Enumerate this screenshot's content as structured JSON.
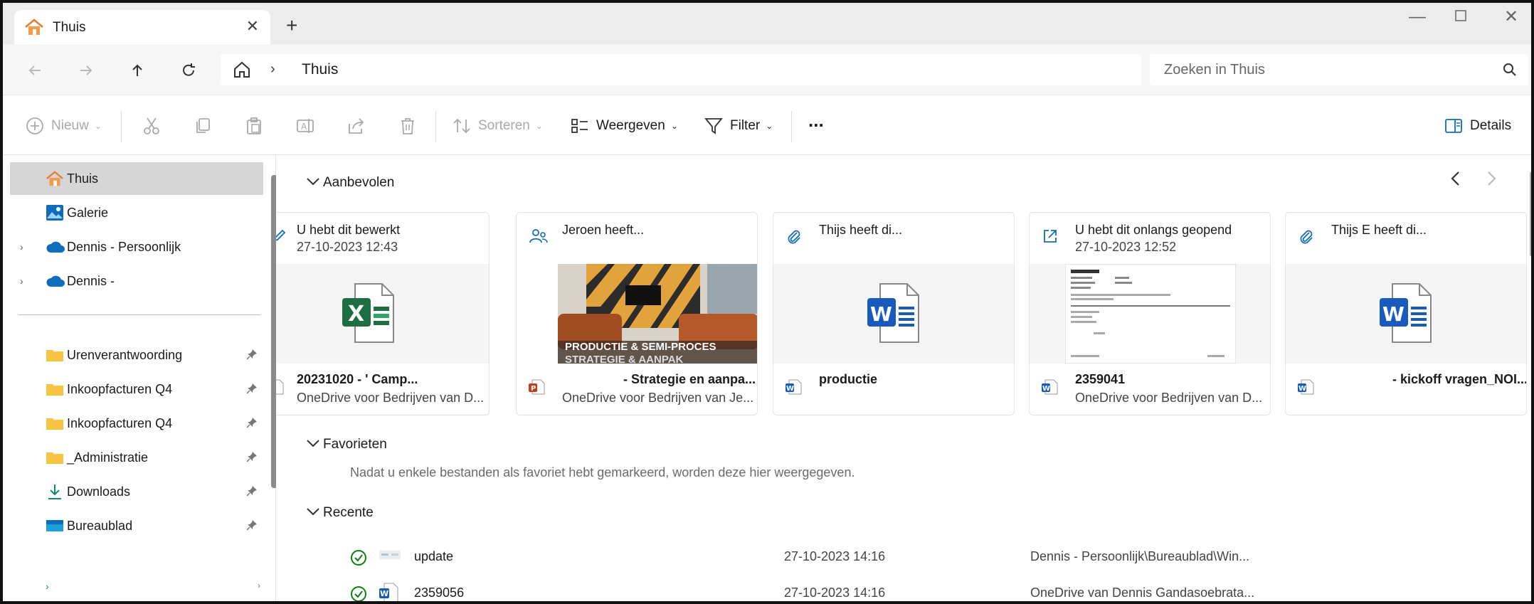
{
  "tab": {
    "title": "Thuis"
  },
  "address": {
    "current": "Thuis"
  },
  "search": {
    "placeholder": "Zoeken in Thuis"
  },
  "toolbar": {
    "new_label": "Nieuw",
    "sort_label": "Sorteren",
    "view_label": "Weergeven",
    "filter_label": "Filter",
    "more_label": "...",
    "details_label": "Details"
  },
  "sidebar": {
    "items": [
      {
        "label": "Thuis"
      },
      {
        "label": "Galerie"
      },
      {
        "label": "Dennis - Persoonlijk"
      },
      {
        "label": "Dennis -"
      }
    ],
    "pinned": [
      {
        "label": "Urenverantwoording"
      },
      {
        "label": "Inkoopfacturen Q4"
      },
      {
        "label": "Inkoopfacturen Q4"
      },
      {
        "label": "_Administratie"
      },
      {
        "label": "Downloads"
      },
      {
        "label": "Bureaublad"
      }
    ],
    "footer": "›"
  },
  "sections": {
    "recommended": "Aanbevolen",
    "favorites": "Favorieten",
    "favorites_empty": "Nadat u enkele bestanden als favoriet hebt gemarkeerd, worden deze hier weergegeven.",
    "recent": "Recente"
  },
  "recommended": [
    {
      "activity": "U hebt dit bewerkt",
      "time": "27-10-2023 12:43",
      "name": "20231020 -                    ' Camp...",
      "location": "OneDrive voor Bedrijven van D...",
      "icon": "excel-icon"
    },
    {
      "activity": "Jeroen                           heeft...",
      "time": "",
      "name": "- Strategie en aanpa...",
      "location": "OneDrive voor Bedrijven van Je...",
      "thumb_caption": "PRODUCTIE & SEMI-PROCES",
      "thumb_caption2": "STRATEGIE & AANPAK",
      "icon": "powerpoint-icon"
    },
    {
      "activity": "Thijs                       heeft di...",
      "time": "",
      "name": "productie",
      "location": "",
      "icon": "word-icon"
    },
    {
      "activity": "U hebt dit onlangs geopend",
      "time": "27-10-2023 12:52",
      "name": "2359041",
      "location": "OneDrive voor Bedrijven van D...",
      "icon": "word-icon"
    },
    {
      "activity": "Thijs                       E heeft di...",
      "time": "",
      "name": "- kickoff vragen_NOI...",
      "location": "",
      "icon": "word-icon"
    }
  ],
  "recent": [
    {
      "name": "update",
      "date": "27-10-2023 14:16",
      "location": "Dennis - Persoonlijk\\Bureaublad\\Win..."
    },
    {
      "name": "2359056",
      "date": "27-10-2023 14:16",
      "location": "OneDrive van Dennis Gandasoebrata..."
    }
  ],
  "colors": {
    "excel": "#1D6F42",
    "word": "#185ABD",
    "powerpoint": "#C43E1C",
    "onedrive": "#0F6CBD",
    "folder": "#F8C441",
    "sync_ok": "#107C10"
  }
}
